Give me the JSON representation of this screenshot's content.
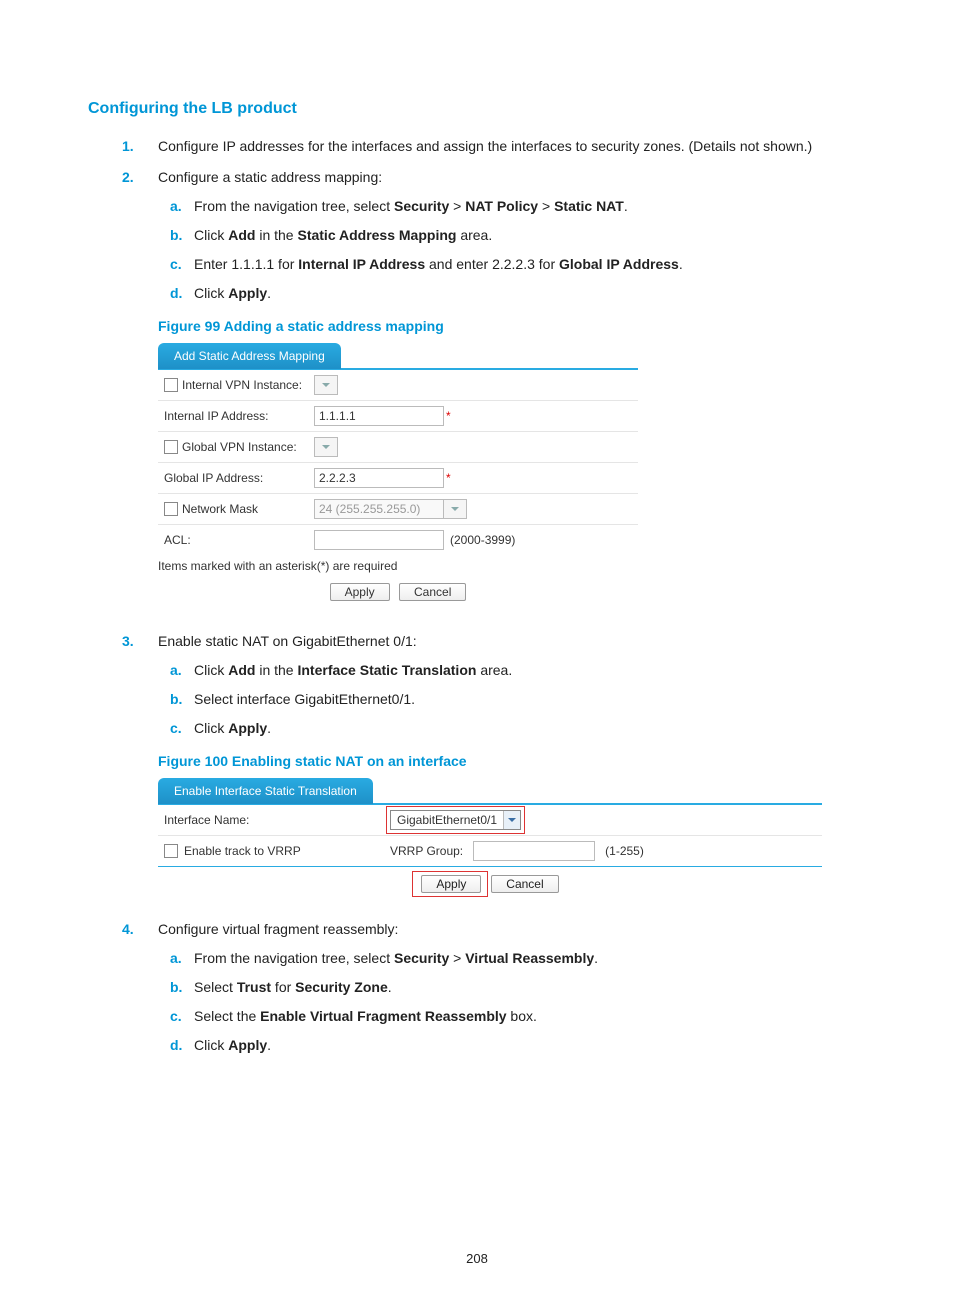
{
  "title": "Configuring the LB product",
  "steps": {
    "s1": {
      "marker": "1.",
      "text": "Configure IP addresses for the interfaces and assign the interfaces to security zones. (Details not shown.)"
    },
    "s2": {
      "marker": "2.",
      "text": "Configure a static address mapping:"
    },
    "s2a": {
      "marker": "a.",
      "pre": "From the navigation tree, select ",
      "b1": "Security",
      "sep1": " > ",
      "b2": "NAT Policy",
      "sep2": " > ",
      "b3": "Static NAT",
      "post": "."
    },
    "s2b": {
      "marker": "b.",
      "pre": "Click ",
      "b1": "Add",
      "mid": " in the ",
      "b2": "Static Address Mapping",
      "post": " area."
    },
    "s2c": {
      "marker": "c.",
      "pre": "Enter 1.1.1.1 for ",
      "b1": "Internal IP Address",
      "mid": " and enter 2.2.2.3 for ",
      "b2": "Global IP Address",
      "post": "."
    },
    "s2d": {
      "marker": "d.",
      "pre": "Click ",
      "b1": "Apply",
      "post": "."
    },
    "s3": {
      "marker": "3.",
      "text": "Enable static NAT on GigabitEthernet 0/1:"
    },
    "s3a": {
      "marker": "a.",
      "pre": "Click ",
      "b1": "Add",
      "mid": " in the ",
      "b2": "Interface Static Translation",
      "post": " area."
    },
    "s3b": {
      "marker": "b.",
      "text": "Select interface GigabitEthernet0/1."
    },
    "s3c": {
      "marker": "c.",
      "pre": "Click ",
      "b1": "Apply",
      "post": "."
    },
    "s4": {
      "marker": "4.",
      "text": "Configure virtual fragment reassembly:"
    },
    "s4a": {
      "marker": "a.",
      "pre": "From the navigation tree, select ",
      "b1": "Security",
      "sep1": " > ",
      "b2": "Virtual Reassembly",
      "post": "."
    },
    "s4b": {
      "marker": "b.",
      "pre": "Select ",
      "b1": "Trust",
      "mid": " for ",
      "b2": "Security Zone",
      "post": "."
    },
    "s4c": {
      "marker": "c.",
      "pre": "Select the ",
      "b1": "Enable Virtual Fragment Reassembly",
      "post": " box."
    },
    "s4d": {
      "marker": "d.",
      "pre": "Click ",
      "b1": "Apply",
      "post": "."
    }
  },
  "fig99": {
    "caption": "Figure 99 Adding a static address mapping",
    "tab": "Add Static Address Mapping",
    "rows": {
      "r1_label": "Internal VPN Instance:",
      "r2_label": "Internal IP Address:",
      "r2_value": "1.1.1.1",
      "r3_label": "Global VPN Instance:",
      "r4_label": "Global IP Address:",
      "r4_value": "2.2.2.3",
      "r5_label": "Network Mask",
      "r5_value": "24 (255.255.255.0)",
      "r6_label": "ACL:",
      "r6_hint": "(2000-3999)"
    },
    "note": "Items marked with an asterisk(*) are required",
    "apply": "Apply",
    "cancel": "Cancel",
    "asterisk": "*"
  },
  "fig100": {
    "caption": "Figure 100 Enabling static NAT on an interface",
    "tab": "Enable Interface Static Translation",
    "iface_label": "Interface Name:",
    "iface_value": "GigabitEthernet0/1",
    "vrrp_chk": "Enable track to VRRP",
    "vrrp_group": "VRRP Group:",
    "vrrp_hint": "(1-255)",
    "apply": "Apply",
    "cancel": "Cancel"
  },
  "page_number": "208"
}
